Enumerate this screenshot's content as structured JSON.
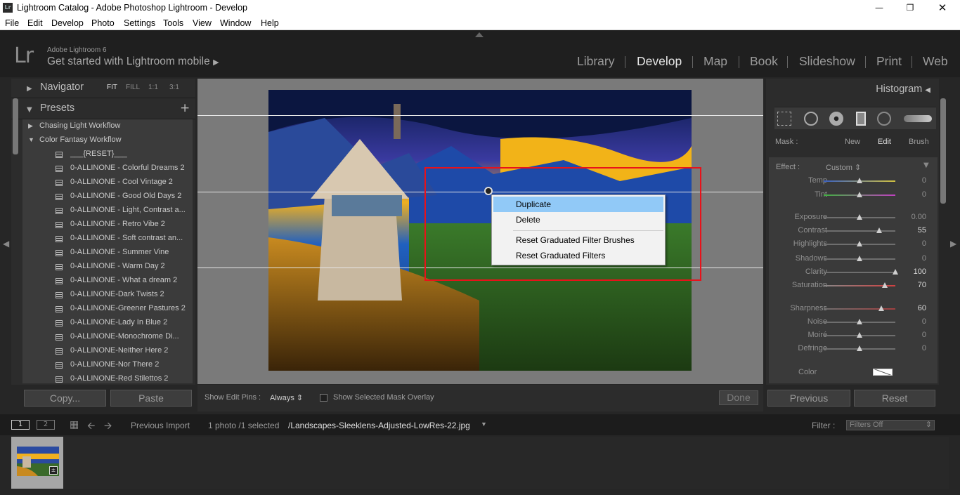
{
  "window": {
    "title": "Lightroom Catalog - Adobe Photoshop Lightroom - Develop",
    "icon_text": "Lr"
  },
  "menu": [
    "File",
    "Edit",
    "Develop",
    "Photo",
    "Settings",
    "Tools",
    "View",
    "Window",
    "Help"
  ],
  "identity": {
    "logo": "Lr",
    "app_name": "Adobe Lightroom 6",
    "mobile_link": "Get started with Lightroom mobile"
  },
  "modules": [
    "Library",
    "Develop",
    "Map",
    "Book",
    "Slideshow",
    "Print",
    "Web"
  ],
  "active_module": "Develop",
  "navigator": {
    "title": "Navigator",
    "options": [
      "FIT",
      "FILL",
      "1:1",
      "3:1"
    ],
    "selected": "FIT"
  },
  "presets": {
    "title": "Presets",
    "add_symbol": "+",
    "folders": [
      {
        "name": "Chasing Light Workflow",
        "expanded": false
      },
      {
        "name": "Color Fantasy Workflow",
        "expanded": true
      }
    ],
    "items": [
      "___{RESET}___",
      "0-ALLINONE - Colorful Dreams 2",
      "0-ALLINONE - Cool Vintage 2",
      "0-ALLINONE - Good Old Days 2",
      "0-ALLINONE - Light, Contrast a...",
      "0-ALLINONE - Retro Vibe 2",
      "0-ALLINONE - Soft contrast an...",
      "0-ALLINONE - Summer Vine",
      "0-ALLINONE - Warm Day 2",
      "0-ALLINONE - What a dream 2",
      "0-ALLINONE-Dark Twists 2",
      "0-ALLINONE-Greener Pastures 2",
      "0-ALLINONE-Lady In Blue 2",
      "0-ALLINONE-Monochrome Di...",
      "0-ALLINONE-Neither Here 2",
      "0-ALLINONE-Nor There 2",
      "0-ALLINONE-Red Stilettos 2"
    ]
  },
  "left_buttons": {
    "copy": "Copy...",
    "paste": "Paste"
  },
  "context_menu": {
    "items": [
      "Duplicate",
      "Delete",
      "Reset Graduated Filter Brushes",
      "Reset Graduated Filters"
    ],
    "highlighted": "Duplicate"
  },
  "toolbar": {
    "show_edit_pins_label": "Show Edit Pins :",
    "show_edit_pins_value": "Always",
    "overlay_label": "Show Selected Mask Overlay",
    "done": "Done"
  },
  "right_panel": {
    "histogram": "Histogram",
    "mask_label": "Mask :",
    "mask_options": [
      "New",
      "Edit",
      "Brush"
    ],
    "mask_selected": "Edit",
    "effect_label": "Effect :",
    "effect_value": "Custom",
    "sliders": [
      {
        "label": "Temp",
        "value": "0",
        "level": 0.5
      },
      {
        "label": "Tint",
        "value": "0",
        "level": 0.5
      },
      {
        "label": "Exposure",
        "value": "0.00",
        "level": 0.5
      },
      {
        "label": "Contrast",
        "value": "55",
        "level": 0.775
      },
      {
        "label": "Highlights",
        "value": "0",
        "level": 0.5
      },
      {
        "label": "Shadows",
        "value": "0",
        "level": 0.5
      },
      {
        "label": "Clarity",
        "value": "100",
        "level": 1.0
      },
      {
        "label": "Saturation",
        "value": "70",
        "level": 0.85
      },
      {
        "label": "Sharpness",
        "value": "60",
        "level": 0.8
      },
      {
        "label": "Noise",
        "value": "0",
        "level": 0.5
      },
      {
        "label": "Moiré",
        "value": "0",
        "level": 0.5
      },
      {
        "label": "Defringe",
        "value": "0",
        "level": 0.5
      }
    ],
    "color_label": "Color"
  },
  "right_buttons": {
    "previous": "Previous",
    "reset": "Reset"
  },
  "filmstrip": {
    "view1": "1",
    "view2": "2",
    "source": "Previous Import",
    "count": "1 photo /1 selected",
    "filename": "/Landscapes-Sleeklens-Adjusted-LowRes-22.jpg",
    "filter_label": "Filter :",
    "filter_value": "Filters Off"
  },
  "colors": {
    "selection_red": "#e8121a",
    "menu_highlight": "#91c9f7"
  }
}
